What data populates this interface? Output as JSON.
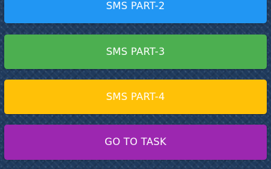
{
  "buttons": [
    {
      "label": "SMS PART-2",
      "color": "#2196f3"
    },
    {
      "label": "SMS PART-3",
      "color": "#4caf50"
    },
    {
      "label": "SMS PART-4",
      "color": "#ffc107"
    },
    {
      "label": "GO TO TASK",
      "color": "#9c27b0"
    }
  ]
}
